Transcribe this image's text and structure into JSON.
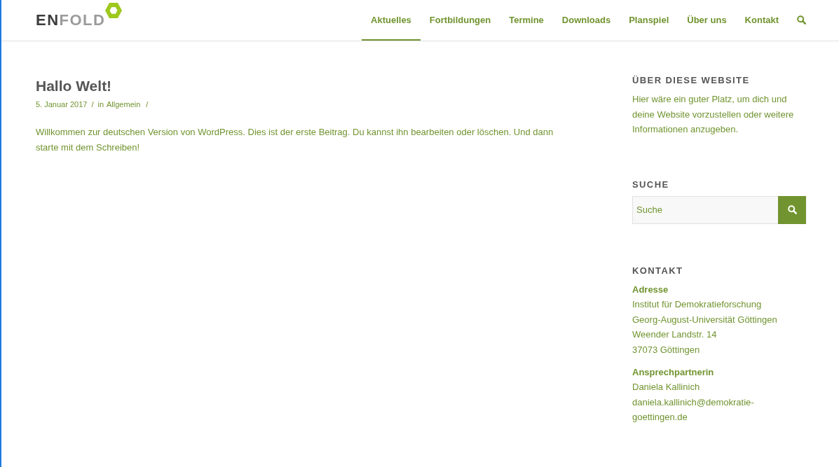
{
  "header": {
    "logo": {
      "parts": [
        {
          "text": "EN",
          "dim": false
        },
        {
          "text": "FOLD",
          "dim": true
        }
      ]
    },
    "nav": [
      {
        "label": "Aktuelles",
        "selected": true
      },
      {
        "label": "Fortbildungen",
        "selected": false
      },
      {
        "label": "Termine",
        "selected": false
      },
      {
        "label": "Downloads",
        "selected": false
      },
      {
        "label": "Planspiel",
        "selected": false
      },
      {
        "label": "Über uns",
        "selected": false
      },
      {
        "label": "Kontakt",
        "selected": false
      }
    ]
  },
  "post": {
    "title": "Hallo Welt!",
    "meta": [
      {
        "kind": "date",
        "text": "5. Januar 2017"
      },
      {
        "kind": "separator",
        "text": "/"
      },
      {
        "kind": "text",
        "text": "in"
      },
      {
        "kind": "category",
        "text": "Allgemein"
      },
      {
        "kind": "separator",
        "text": "/"
      }
    ],
    "body": "Willkommen zur deutschen Version von WordPress. Dies ist der erste Beitrag. Du kannst ihn bearbeiten oder löschen. Und dann starte mit dem Schreiben!"
  },
  "sidebar": {
    "widgets": [
      {
        "kind": "text",
        "title": "ÜBER DIESE WEBSITE",
        "text": "Hier wäre ein guter Platz, um dich und deine Website vorzustellen oder weitere Informationen anzugeben."
      },
      {
        "kind": "search",
        "title": "SUCHE",
        "search": {
          "placeholder": "Suche"
        }
      },
      {
        "kind": "contact",
        "title": "KONTAKT",
        "groups": [
          {
            "heading": "Adresse",
            "lines": [
              "Institut für Demokratieforschung",
              "Georg-August-Universität Göttingen",
              "Weender Landstr. 14",
              "37073 Göttingen"
            ]
          },
          {
            "heading": "Ansprechpartnerin",
            "lines": [
              "Daniela Kallinich",
              "daniela.kallinich@demokratie-goettingen.de"
            ]
          }
        ]
      }
    ]
  }
}
